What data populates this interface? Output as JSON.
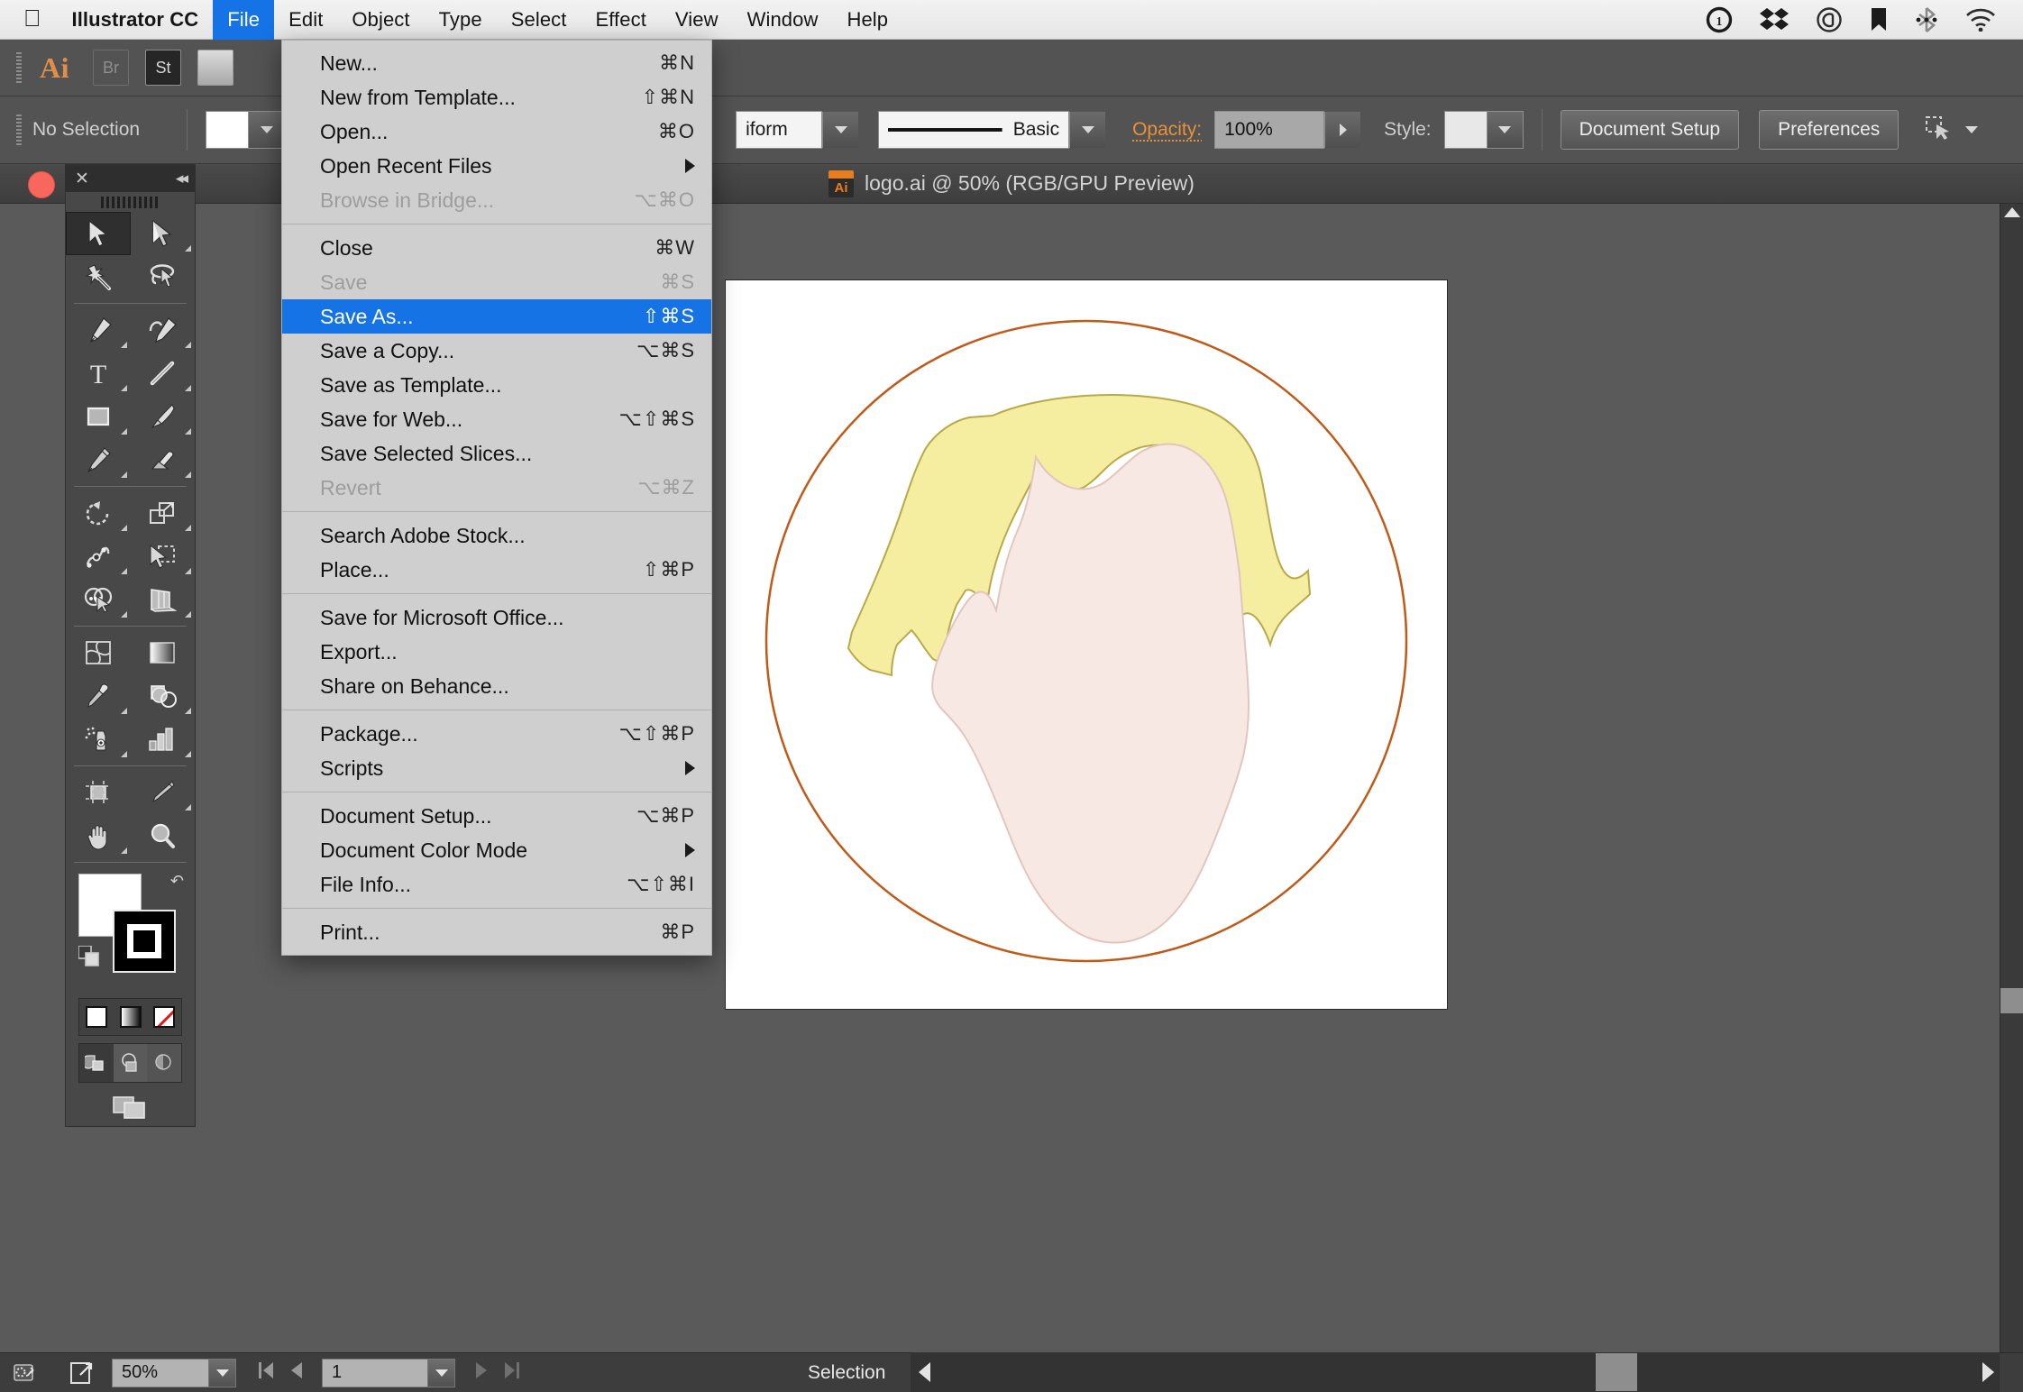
{
  "macbar": {
    "apple_icon": "apple-logo",
    "items": [
      {
        "label": "Illustrator CC",
        "bold": true,
        "active": false
      },
      {
        "label": "File",
        "bold": false,
        "active": true
      },
      {
        "label": "Edit",
        "bold": false,
        "active": false
      },
      {
        "label": "Object",
        "bold": false,
        "active": false
      },
      {
        "label": "Type",
        "bold": false,
        "active": false
      },
      {
        "label": "Select",
        "bold": false,
        "active": false
      },
      {
        "label": "Effect",
        "bold": false,
        "active": false
      },
      {
        "label": "View",
        "bold": false,
        "active": false
      },
      {
        "label": "Window",
        "bold": false,
        "active": false
      },
      {
        "label": "Help",
        "bold": false,
        "active": false
      }
    ],
    "status_icons": [
      "onepassword-icon",
      "dropbox-icon",
      "creative-cloud-icon",
      "bookmark-icon",
      "bluetooth-icon",
      "wifi-icon"
    ]
  },
  "appbar": {
    "logo": "Ai",
    "bridge_label": "Br",
    "stock_label": "St"
  },
  "controlbar": {
    "selection_status": "No Selection",
    "fill_swatch_color": "#ffffff",
    "stroke_swatch_color": "#ffffff",
    "stroke_profile": "iform",
    "brush_definition": "Basic",
    "opacity_label": "Opacity:",
    "opacity_value": "100%",
    "style_label": "Style:",
    "style_swatch_color": "#e8e8e8",
    "document_setup_button": "Document Setup",
    "preferences_button": "Preferences",
    "extra_icon": "align-objects-icon"
  },
  "document_tab": {
    "icon": "illustrator-file-icon",
    "icon_label": "Ai",
    "title": "logo.ai @ 50% (RGB/GPU Preview)"
  },
  "file_menu": {
    "groups": [
      [
        {
          "label": "New...",
          "shortcut": "⌘N",
          "disabled": false,
          "highlighted": false,
          "submenu": false
        },
        {
          "label": "New from Template...",
          "shortcut": "⇧⌘N",
          "disabled": false,
          "highlighted": false,
          "submenu": false
        },
        {
          "label": "Open...",
          "shortcut": "⌘O",
          "disabled": false,
          "highlighted": false,
          "submenu": false
        },
        {
          "label": "Open Recent Files",
          "shortcut": "",
          "disabled": false,
          "highlighted": false,
          "submenu": true
        },
        {
          "label": "Browse in Bridge...",
          "shortcut": "⌥⌘O",
          "disabled": true,
          "highlighted": false,
          "submenu": false
        }
      ],
      [
        {
          "label": "Close",
          "shortcut": "⌘W",
          "disabled": false,
          "highlighted": false,
          "submenu": false
        },
        {
          "label": "Save",
          "shortcut": "⌘S",
          "disabled": true,
          "highlighted": false,
          "submenu": false
        },
        {
          "label": "Save As...",
          "shortcut": "⇧⌘S",
          "disabled": false,
          "highlighted": true,
          "submenu": false
        },
        {
          "label": "Save a Copy...",
          "shortcut": "⌥⌘S",
          "disabled": false,
          "highlighted": false,
          "submenu": false
        },
        {
          "label": "Save as Template...",
          "shortcut": "",
          "disabled": false,
          "highlighted": false,
          "submenu": false
        },
        {
          "label": "Save for Web...",
          "shortcut": "⌥⇧⌘S",
          "disabled": false,
          "highlighted": false,
          "submenu": false
        },
        {
          "label": "Save Selected Slices...",
          "shortcut": "",
          "disabled": false,
          "highlighted": false,
          "submenu": false
        },
        {
          "label": "Revert",
          "shortcut": "⌥⌘Z",
          "disabled": true,
          "highlighted": false,
          "submenu": false
        }
      ],
      [
        {
          "label": "Search Adobe Stock...",
          "shortcut": "",
          "disabled": false,
          "highlighted": false,
          "submenu": false
        },
        {
          "label": "Place...",
          "shortcut": "⇧⌘P",
          "disabled": false,
          "highlighted": false,
          "submenu": false
        }
      ],
      [
        {
          "label": "Save for Microsoft Office...",
          "shortcut": "",
          "disabled": false,
          "highlighted": false,
          "submenu": false
        },
        {
          "label": "Export...",
          "shortcut": "",
          "disabled": false,
          "highlighted": false,
          "submenu": false
        },
        {
          "label": "Share on Behance...",
          "shortcut": "",
          "disabled": false,
          "highlighted": false,
          "submenu": false
        }
      ],
      [
        {
          "label": "Package...",
          "shortcut": "⌥⇧⌘P",
          "disabled": false,
          "highlighted": false,
          "submenu": false
        },
        {
          "label": "Scripts",
          "shortcut": "",
          "disabled": false,
          "highlighted": false,
          "submenu": true
        }
      ],
      [
        {
          "label": "Document Setup...",
          "shortcut": "⌥⌘P",
          "disabled": false,
          "highlighted": false,
          "submenu": false
        },
        {
          "label": "Document Color Mode",
          "shortcut": "",
          "disabled": false,
          "highlighted": false,
          "submenu": true
        },
        {
          "label": "File Info...",
          "shortcut": "⌥⇧⌘I",
          "disabled": false,
          "highlighted": false,
          "submenu": false
        }
      ],
      [
        {
          "label": "Print...",
          "shortcut": "⌘P",
          "disabled": false,
          "highlighted": false,
          "submenu": false
        }
      ]
    ]
  },
  "tool_panel": {
    "close_icon": "close-icon",
    "collapse_icon": "double-chevron-left-icon",
    "grip_icon": "panel-grip-icon",
    "tools": [
      "selection-tool",
      "direct-selection-tool",
      "magic-wand-tool",
      "lasso-tool",
      "pen-tool",
      "curvature-tool",
      "type-tool",
      "line-segment-tool",
      "rectangle-tool",
      "paintbrush-tool",
      "pencil-tool",
      "eraser-tool",
      "rotate-tool",
      "scale-tool",
      "width-tool",
      "free-transform-tool",
      "shape-builder-tool",
      "perspective-grid-tool",
      "mesh-tool",
      "gradient-tool",
      "eyedropper-tool",
      "blend-tool",
      "symbol-sprayer-tool",
      "column-graph-tool",
      "artboard-tool",
      "slice-tool",
      "hand-tool",
      "zoom-tool"
    ],
    "fill_color": "#ffffff",
    "stroke_color": "#000000",
    "swap_icon": "swap-fill-stroke-icon",
    "default_icon": "default-fill-stroke-icon",
    "color_modes": [
      "color-mode-icon",
      "gradient-mode-icon",
      "none-mode-icon"
    ],
    "screen_modes": [
      "normal-screen-mode-icon",
      "full-screen-menu-bar-icon",
      "full-screen-mode-icon"
    ],
    "drawing_mode_icon": "drawing-modes-icon"
  },
  "statusbar": {
    "settings_icon": "preferences-gear-icon",
    "share_icon": "share-export-icon",
    "zoom_value": "50%",
    "first_page_icon": "first-artboard-icon",
    "prev_page_icon": "previous-artboard-icon",
    "page_value": "1",
    "next_page_icon": "next-artboard-icon",
    "last_page_icon": "last-artboard-icon",
    "status_text": "Selection"
  },
  "artwork": {
    "description": "logo artwork: head profile illustration",
    "circle_stroke_color": "#c05a18",
    "hair_fill_color": "#f5edA0",
    "hair_stroke_color": "#b9a94a",
    "face_fill_color": "#f7e7e3",
    "face_stroke_color": "#e0c4bc",
    "artboard_background": "#ffffff",
    "canvas_background": "#5a5a5a"
  },
  "window": {
    "close_button_color": "#f9665c"
  }
}
